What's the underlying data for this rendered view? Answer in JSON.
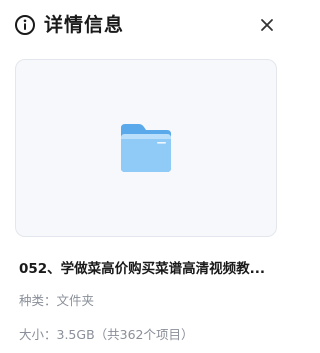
{
  "header": {
    "title": "详情信息",
    "info_icon": "info-circle-icon",
    "close_icon": "close-icon"
  },
  "preview": {
    "icon": "folder-icon",
    "colors": {
      "folder_back": "#5aa9ea",
      "folder_front": "#8fcbf6",
      "folder_front_edge": "#b9dffb"
    }
  },
  "file": {
    "name": "052、学做菜高价购买菜谱高清视频教...",
    "type_label": "种类：文件夹",
    "size_label": "大小：3.5GB（共362个项目）"
  }
}
